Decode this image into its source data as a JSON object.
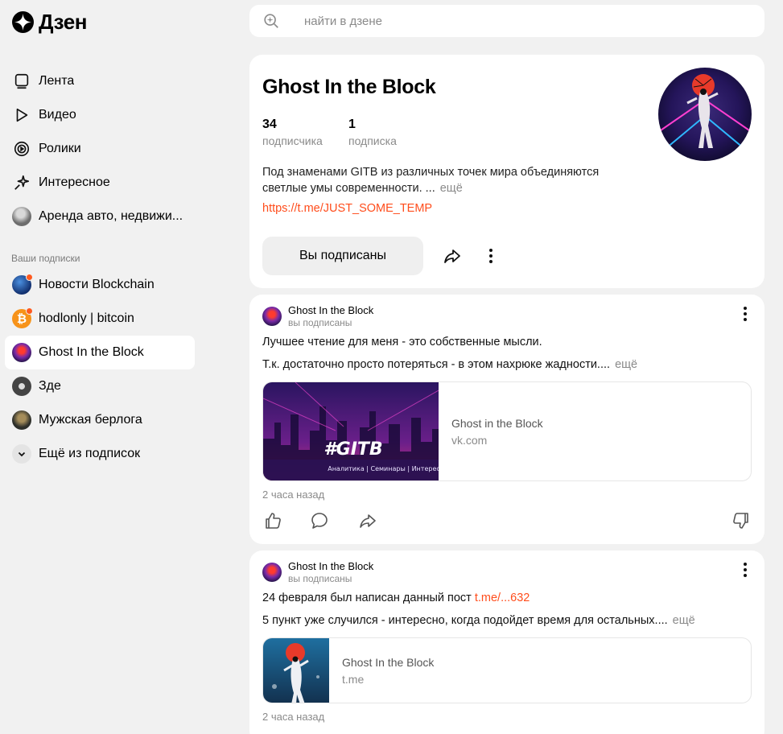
{
  "logo": {
    "text": "Дзен"
  },
  "nav": {
    "items": [
      {
        "label": "Лента",
        "icon": "feed-icon"
      },
      {
        "label": "Видео",
        "icon": "play-icon"
      },
      {
        "label": "Ролики",
        "icon": "shorts-icon"
      },
      {
        "label": "Интересное",
        "icon": "sparkle-icon"
      },
      {
        "label": "Аренда авто, недвижи...",
        "icon": "avatar"
      }
    ]
  },
  "subscriptions": {
    "title": "Ваши подписки",
    "items": [
      {
        "label": "Новости Blockchain",
        "has_dot": true
      },
      {
        "label": "hodlonly | bitcoin",
        "has_dot": true
      },
      {
        "label": "Ghost In the Block",
        "active": true
      },
      {
        "label": "Зде"
      },
      {
        "label": "Мужская берлога"
      }
    ],
    "more_label": "Ещё из подписок"
  },
  "search": {
    "placeholder": "найти в дзене"
  },
  "profile": {
    "title": "Ghost In the Block",
    "subscribers_count": "34",
    "subscribers_label": "подписчика",
    "subscriptions_count": "1",
    "subscriptions_label": "подписка",
    "description_line1": "Под знаменами GITB из различных точек мира объединяются",
    "description_line2": "светлые умы современности. ...",
    "more": "ещё",
    "link": "https://t.me/JUST_SOME_TEMP",
    "subscribe_button": "Вы подписаны"
  },
  "posts": [
    {
      "author": "Ghost In the Block",
      "status": "вы подписаны",
      "line1": "Лучшее чтение для меня - это собственные мысли.",
      "line2": "Т.к. достаточно просто потеряться - в этом нахрюке жадности....",
      "more": "ещё",
      "link_title": "Ghost in the Block",
      "link_domain": "vk.com",
      "banner_text": "#GITB",
      "banner_sub": "Аналитика | Семинары | Интерес",
      "time": "2 часа назад"
    },
    {
      "author": "Ghost In the Block",
      "status": "вы подписаны",
      "line1_text": "24 февраля был написан данный пост ",
      "line1_link": "t.me/...632",
      "line2": "5 пункт уже случился - интересно, когда подойдет время для остальных....",
      "more": "ещё",
      "link_title": "Ghost In the Block",
      "link_domain": "t.me",
      "time": "2 часа назад"
    }
  ],
  "colors": {
    "accent": "#ff4d1c",
    "background": "#f1f1f1",
    "card": "#ffffff"
  }
}
